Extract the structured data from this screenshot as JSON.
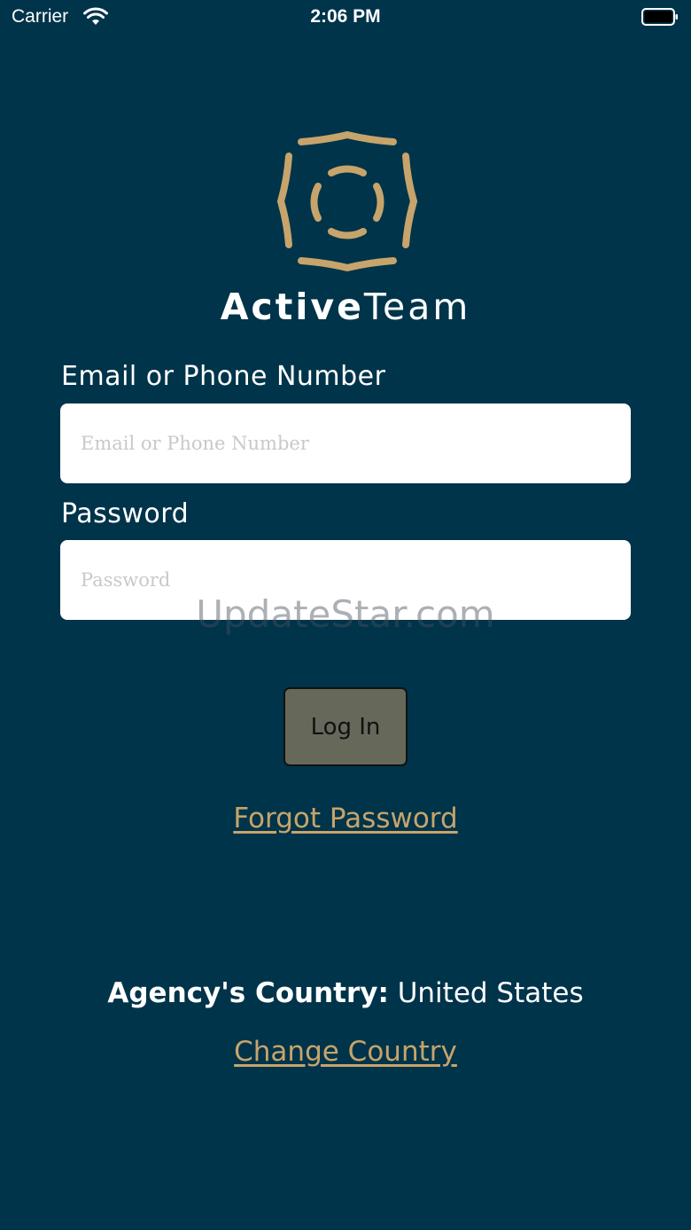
{
  "status_bar": {
    "carrier": "Carrier",
    "time": "2:06 PM",
    "wifi_icon": "wifi-icon",
    "battery_icon": "battery-icon"
  },
  "brand": {
    "name_bold": "Active",
    "name_regular": "Team",
    "logo_icon": "active-team-logo-icon",
    "logo_color": "#c7a46b"
  },
  "form": {
    "email_label": "Email or Phone Number",
    "email_placeholder": "Email or Phone Number",
    "email_value": "",
    "password_label": "Password",
    "password_placeholder": "Password",
    "password_value": "",
    "login_label": "Log In",
    "forgot_label": "Forgot Password"
  },
  "watermark": "UpdateStar.com",
  "country": {
    "label": "Agency's Country:",
    "value": "United States",
    "change_label": "Change Country"
  },
  "colors": {
    "background": "#00344a",
    "accent": "#c7a46b",
    "button": "#66695a"
  }
}
